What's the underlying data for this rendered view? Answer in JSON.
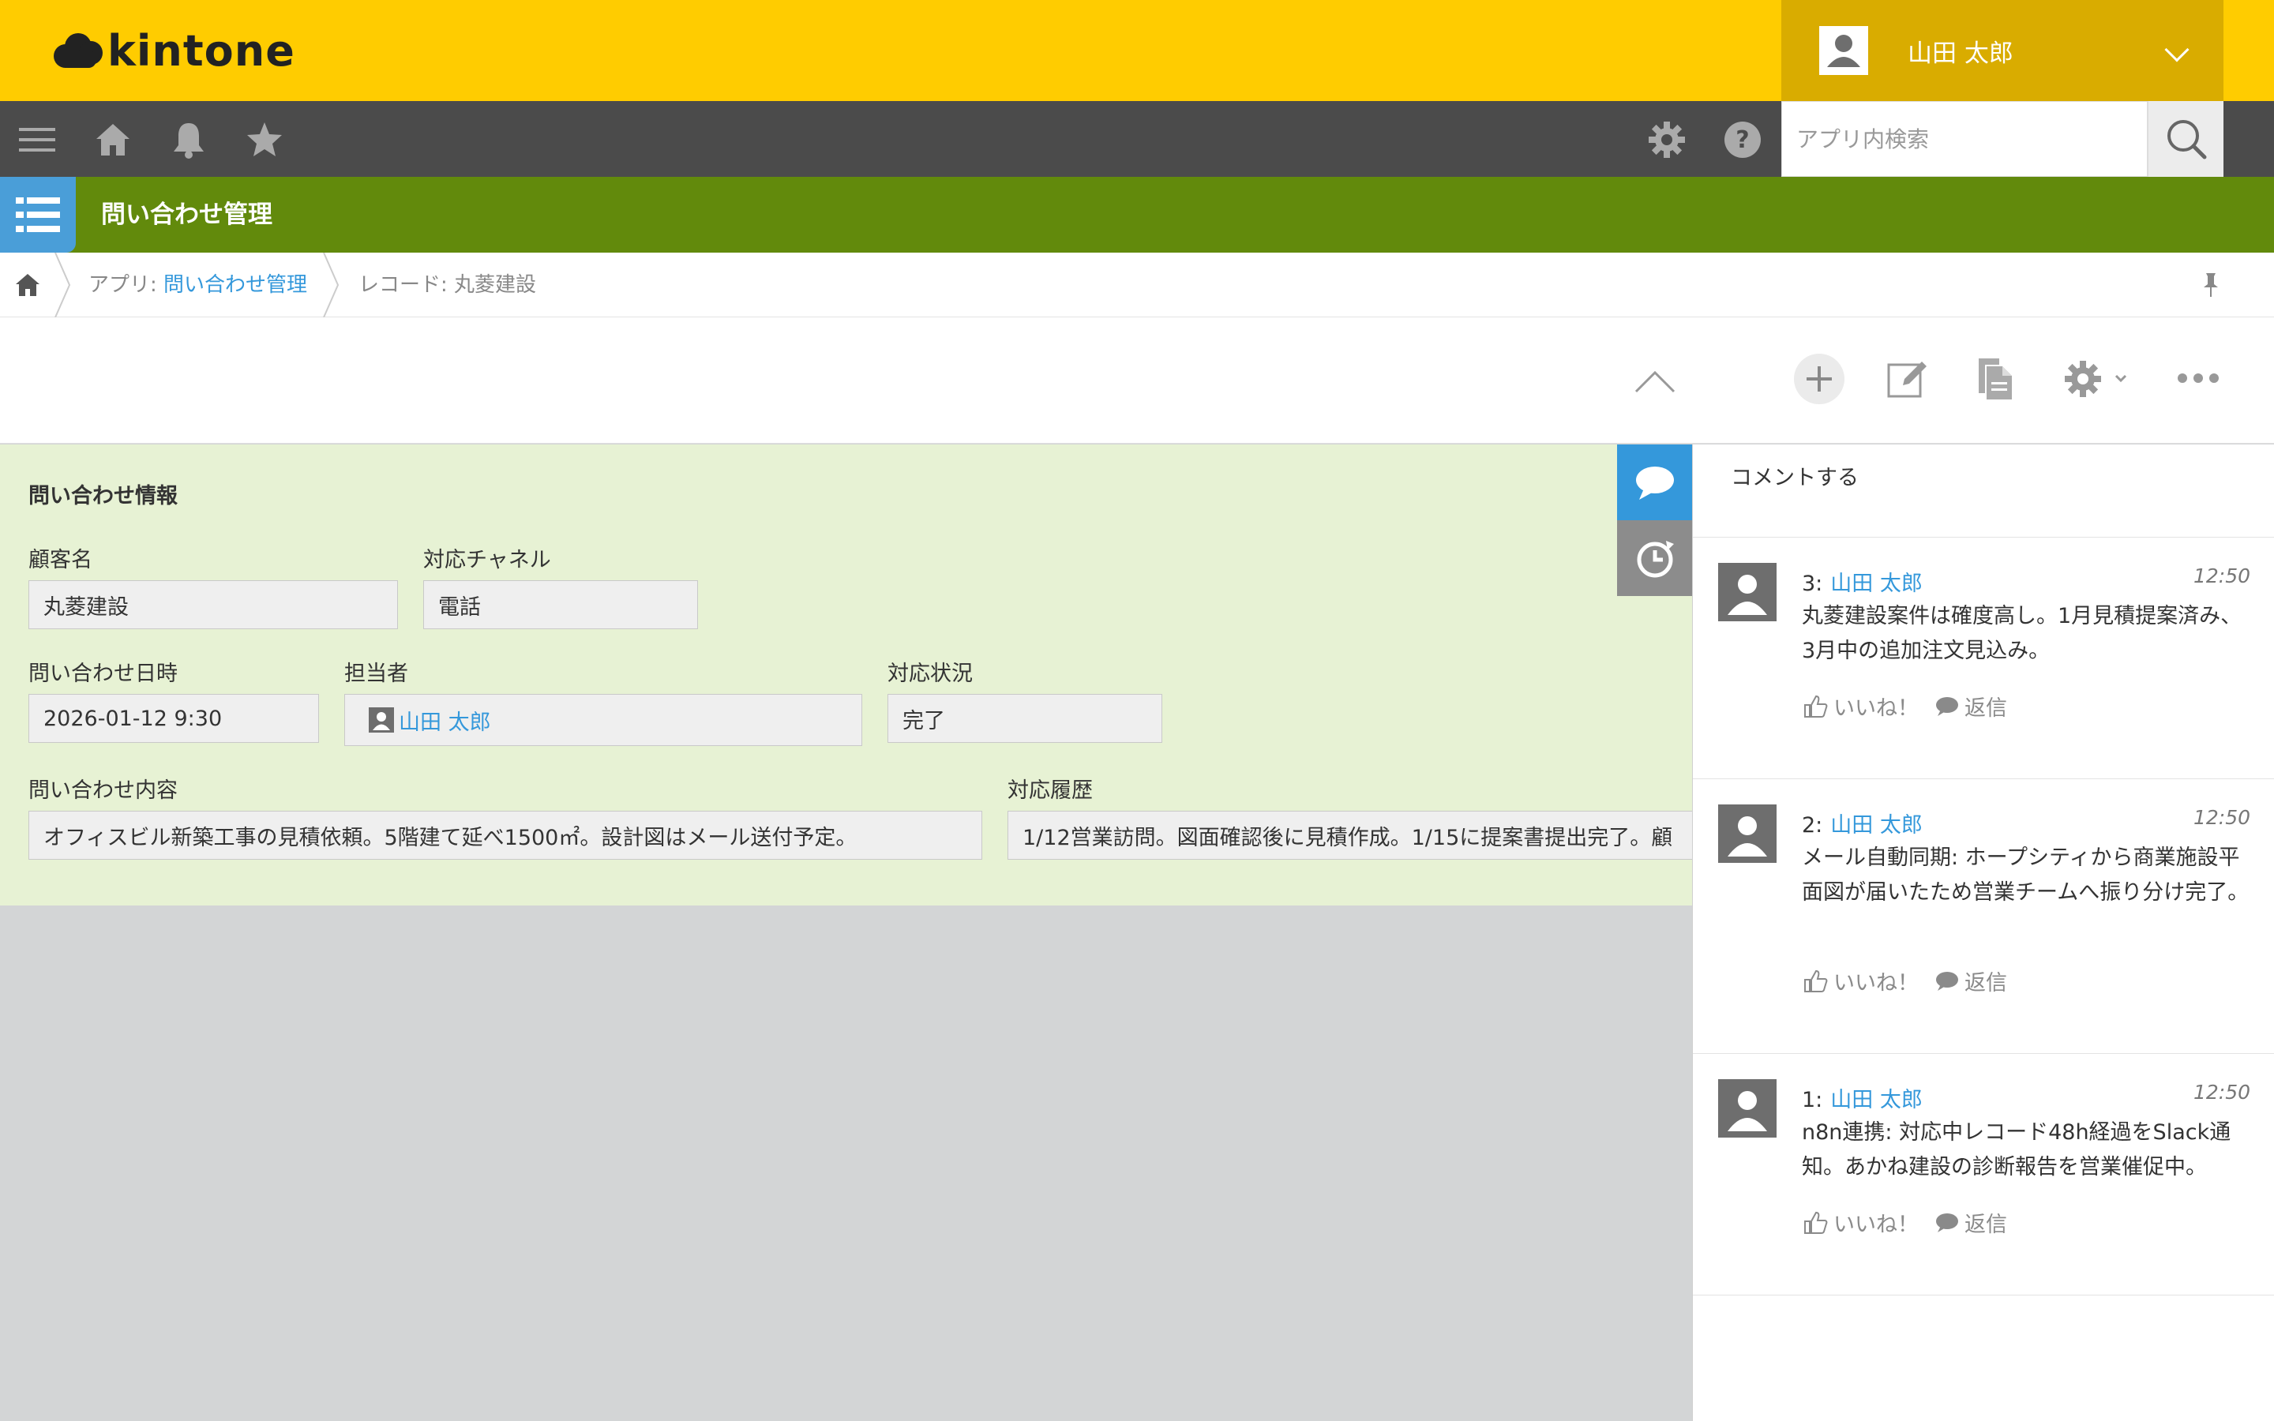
{
  "header": {
    "logo_text": "kintone",
    "user_name": "山田 太郎",
    "search_placeholder": "アプリ内検索"
  },
  "app": {
    "title": "問い合わせ管理"
  },
  "breadcrumb": {
    "app_prefix": "アプリ: ",
    "app_link": "問い合わせ管理",
    "record": "レコード: 丸菱建設"
  },
  "form": {
    "section_title": "問い合わせ情報",
    "fields": {
      "customer_label": "顧客名",
      "customer_value": "丸菱建設",
      "channel_label": "対応チャネル",
      "channel_value": "電話",
      "datetime_label": "問い合わせ日時",
      "datetime_value": "2026-01-12 9:30",
      "assignee_label": "担当者",
      "assignee_value": "山田 太郎",
      "status_label": "対応状況",
      "status_value": "完了",
      "content_label": "問い合わせ内容",
      "content_value": "オフィスビル新築工事の見積依頼。5階建て延べ1500㎡。設計図はメール送付予定。",
      "history_label": "対応履歴",
      "history_value": "1/12営業訪問。図面確認後に見積作成。1/15に提案書提出完了。顧"
    }
  },
  "comments": {
    "input_placeholder": "コメントする",
    "like_label": "いいね！",
    "reply_label": "返信",
    "items": [
      {
        "num": "3:",
        "user": "山田 太郎",
        "time": "12:50",
        "body": "丸菱建設案件は確度高し。1月見積提案済み、3月中の追加注文見込み。"
      },
      {
        "num": "2:",
        "user": "山田 太郎",
        "time": "12:50",
        "body": "メール自動同期: ホープシティから商業施設平面図が届いたため営業チームへ振り分け完了。"
      },
      {
        "num": "1:",
        "user": "山田 太郎",
        "time": "12:50",
        "body": "n8n連携: 対応中レコード48h経過をSlack通知。あかね建設の診断報告を営業催促中。"
      }
    ]
  },
  "colors": {
    "header_yellow": "#ffcc00",
    "nav_dark": "#4b4b4b",
    "app_green": "#628a0c",
    "form_bg": "#e7f2d4",
    "link_blue": "#3498db"
  }
}
